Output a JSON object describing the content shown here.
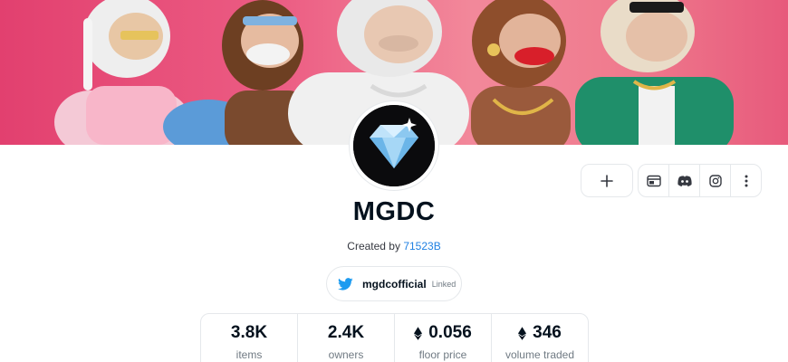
{
  "banner": {
    "description_icon": "banner-image",
    "colors": {
      "start": "#e2406f",
      "end": "#e75a7c"
    }
  },
  "collection": {
    "name": "MGDC",
    "created_prefix": "Created by",
    "creator": "71523B",
    "avatar_icon": "diamond-icon"
  },
  "actions": {
    "add_icon": "plus-icon",
    "links": [
      {
        "icon": "website-icon"
      },
      {
        "icon": "discord-icon"
      },
      {
        "icon": "instagram-icon"
      },
      {
        "icon": "more-vertical-icon"
      }
    ]
  },
  "twitter": {
    "icon": "twitter-icon",
    "handle": "mgdcofficial",
    "status": "Linked",
    "color": "#1d9bf0"
  },
  "stats": [
    {
      "value": "3.8K",
      "label": "items",
      "eth": false
    },
    {
      "value": "2.4K",
      "label": "owners",
      "eth": false
    },
    {
      "value": "0.056",
      "label": "floor price",
      "eth": true
    },
    {
      "value": "346",
      "label": "volume traded",
      "eth": true
    }
  ],
  "colors": {
    "link": "#2081e2",
    "text": "#04111d",
    "muted": "#707a83",
    "border": "#e5e8eb"
  }
}
